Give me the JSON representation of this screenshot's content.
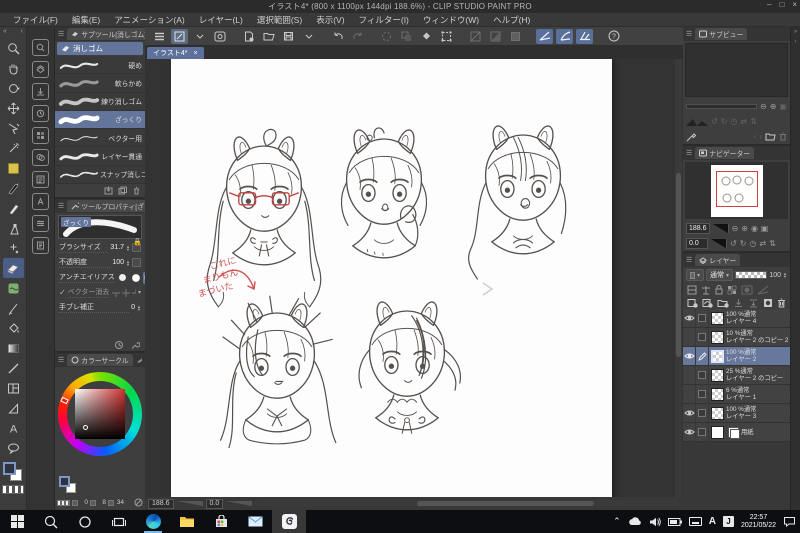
{
  "window": {
    "title": "イラスト4* (800 x 1100px 144dpi 188.6%)  - CLIP STUDIO PAINT PRO",
    "minimize": "–",
    "maximize": "□",
    "close": "×"
  },
  "menu": {
    "items": [
      "ファイル(F)",
      "編集(E)",
      "アニメーション(A)",
      "レイヤー(L)",
      "選択範囲(S)",
      "表示(V)",
      "フィルター(I)",
      "ウィンドウ(W)",
      "ヘルプ(H)"
    ]
  },
  "canvas": {
    "tab": "イラスト4*",
    "tab_close": "×",
    "zoom": "188.6",
    "rotation": "0.0",
    "annotation": {
      "line1": "これに",
      "line2": "まりもん",
      "line3": "まづいた",
      "color": "#d05050"
    }
  },
  "tool_palette": {
    "selected": "eraser",
    "tools": [
      "zoom",
      "hand",
      "rotate-view",
      "move",
      "operation",
      "auto-select",
      "selection",
      "pen",
      "pencil",
      "airbrush",
      "decoration",
      "eraser",
      "blend",
      "liquify",
      "fill",
      "gradient",
      "figure",
      "frame-border",
      "ruler",
      "text",
      "balloon"
    ]
  },
  "subtool": {
    "title": "サブツール[消しゴム]",
    "group": "消しゴム",
    "items": [
      "硬め",
      "軟らかめ",
      "練り消しゴム",
      "ざっくり",
      "ベクター用",
      "レイヤー貫通",
      "スナップ消しゴム"
    ]
  },
  "tool_property": {
    "title": "ツールプロパティ[ざっくり]",
    "preview": "ざっくり",
    "brush_size_label": "ブラシサイズ",
    "brush_size": "31.7",
    "opacity_label": "不透明度",
    "opacity": "100",
    "anti_aliasing_label": "アンチエイリアス",
    "vector_erase_label": "ベクター消去",
    "stabilization_label": "手ブレ補正",
    "stabilization": "0"
  },
  "color_wheel": {
    "title": "カラーサークル",
    "v1": "0",
    "v2": "8",
    "v3": "34"
  },
  "subview": {
    "title": "サブビュー"
  },
  "navigator": {
    "title": "ナビゲーター",
    "zoom": "188.6",
    "rotation": "0.0"
  },
  "layers": {
    "title": "レイヤー",
    "blend_mode": "通常",
    "opacity": "100",
    "items": [
      {
        "mode": "100 %通常",
        "name": "レイヤー 4"
      },
      {
        "mode": "10 %通常",
        "name": "レイヤー 2 のコピー 2"
      },
      {
        "mode": "100 %通常",
        "name": "レイヤー 2"
      },
      {
        "mode": "25 %通常",
        "name": "レイヤー 2 のコピー"
      },
      {
        "mode": "6 %通常",
        "name": "レイヤー 1"
      },
      {
        "mode": "100 %通常",
        "name": "レイヤー 3"
      },
      {
        "mode": "",
        "name": "用紙"
      }
    ]
  },
  "taskbar": {
    "time": "22:57",
    "date": "2021/05/22",
    "ime_mode": "A",
    "ime_lang": "J"
  }
}
